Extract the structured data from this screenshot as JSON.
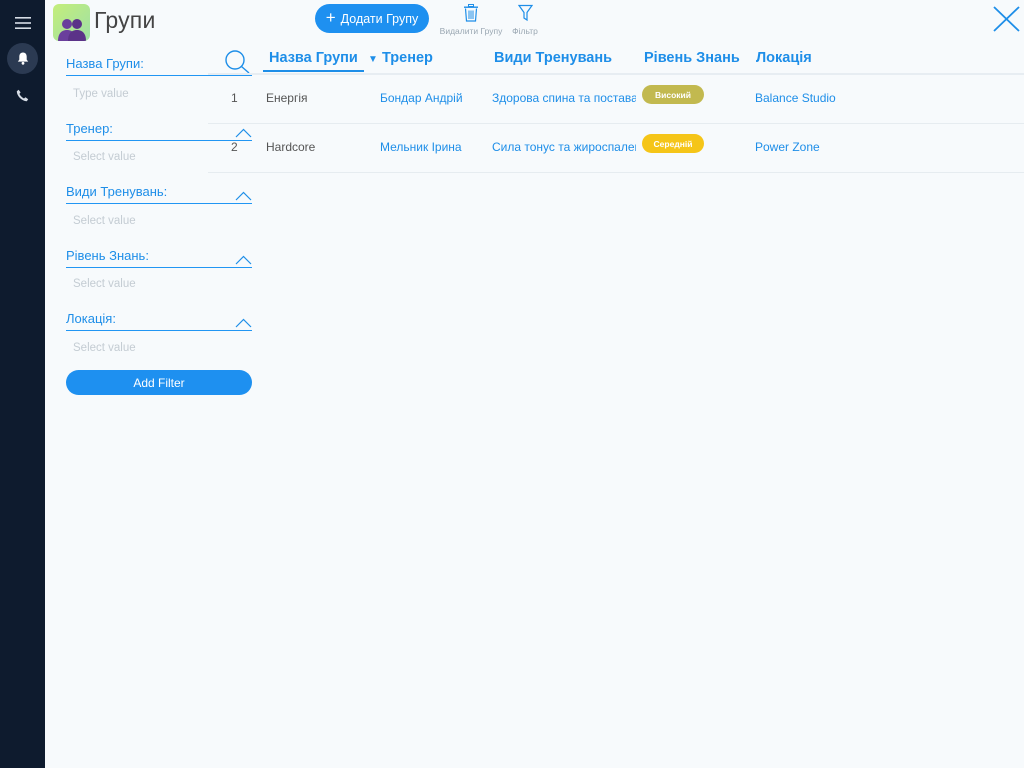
{
  "header": {
    "title": "Групи",
    "add_button": "Додати Групу",
    "delete_label": "Видалити Групу",
    "filter_label": "Фільтр"
  },
  "filters": {
    "group_name": {
      "label": "Назва Групи:",
      "placeholder": "Type value"
    },
    "coach": {
      "label": "Тренер:",
      "placeholder": "Select value"
    },
    "training_types": {
      "label": "Види Тренувань:",
      "placeholder": "Select value"
    },
    "level": {
      "label": "Рівень Знань:",
      "placeholder": "Select value"
    },
    "location": {
      "label": "Локація:",
      "placeholder": "Select value"
    },
    "add_filter": "Add Filter"
  },
  "table": {
    "columns": {
      "name": "Назва Групи",
      "coach": "Тренер",
      "types": "Види Тренувань",
      "level": "Рівень Знань",
      "location": "Локація"
    },
    "rows": [
      {
        "num": "1",
        "name": "Енергія",
        "coach": "Бондар Андрій",
        "types": "Здорова спина та постава",
        "level": "Високий",
        "level_color": "#c2b94f",
        "location": "Balance Studio"
      },
      {
        "num": "2",
        "name": "Hardcore",
        "coach": "Мельник Ірина",
        "types": "Сила   тонус та жироспалення",
        "level": "Середній",
        "level_color": "#f5c518",
        "location": "Power Zone"
      }
    ]
  },
  "colors": {
    "accent": "#1e90f0",
    "rail": "#0e1b2e"
  },
  "icons": [
    "menu-icon",
    "bell-icon",
    "phone-icon",
    "group-icon",
    "trash-icon",
    "funnel-icon",
    "close-icon",
    "search-icon",
    "chevron-up-icon",
    "sort-down-icon"
  ]
}
